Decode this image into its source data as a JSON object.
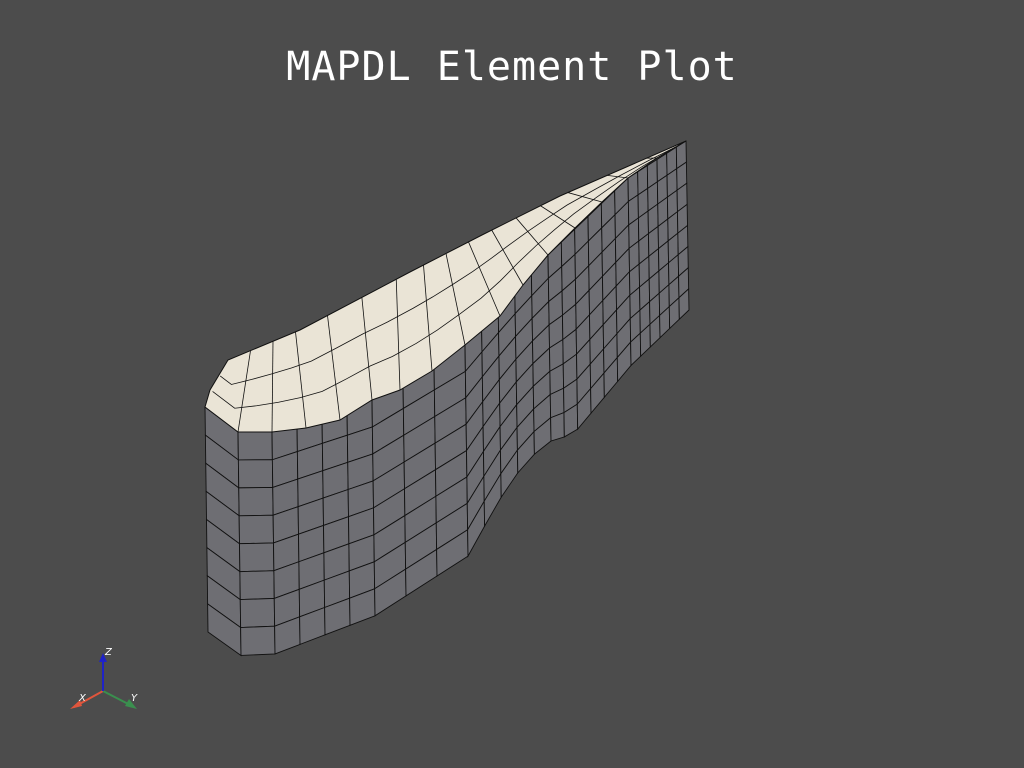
{
  "title": "MAPDL Element Plot",
  "colors": {
    "background": "#4c4c4c",
    "top_face": "#eae4d6",
    "side_face": "#6e6e73",
    "edges": "#111111",
    "axis_x": "#e0553c",
    "axis_y": "#3a8f4e",
    "axis_z": "#1f23c8",
    "text": "#ffffff"
  },
  "axes_widget": {
    "x_label": "X",
    "y_label": "Y",
    "z_label": "Z"
  }
}
